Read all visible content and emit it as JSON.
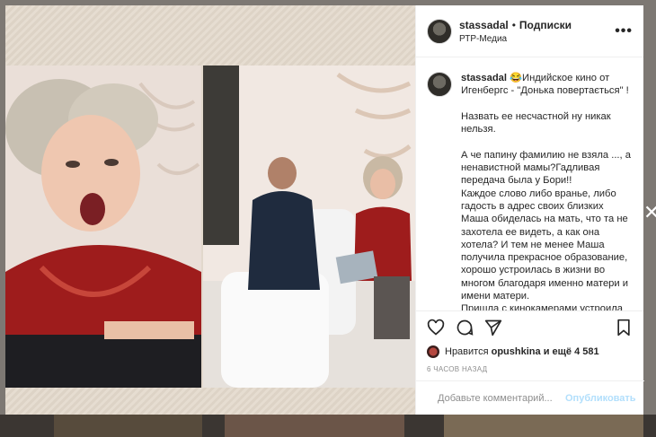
{
  "post": {
    "username": "stassadal",
    "separator": "•",
    "follow_label": "Подписки",
    "location": "РТР-Медиа",
    "more_glyph": "•••"
  },
  "caption": {
    "username": "stassadal",
    "text": "😂Индийское кино от Игенбергс - \"Донька повертається\" !\n\nНазвать ее несчастной ну никак нельзя.\n\nА че папину фамилию не взяла ..., а ненавистной мамы?Гадливая передача была у Бори!!\nКаждое слово либо вранье, либо гадость в адрес своих близких\nМаша обиделась на мать, что та не захотела ее видеть, а как она хотела? И тем не менее Маша получила прекрасное образование, хорошо устроилась в жизни во многом благодаря именно матери и имени матери.\nПришла с кинокамерами устроила видеосъёмку в стиле индийско-"
  },
  "likes": {
    "prefix": "Нравится",
    "user": "opushkina",
    "suffix": "и ещё 4 581"
  },
  "timestamp": "6 ЧАСОВ НАЗАД",
  "comment_box": {
    "placeholder": "Добавьте комментарий...",
    "publish_label": "Опубликовать"
  },
  "media": {
    "overlay_text": "Х"
  },
  "icons": [
    "avatar",
    "heart-icon",
    "comment-icon",
    "share-icon",
    "bookmark-icon",
    "emoji-icon",
    "more-icon"
  ],
  "colors": {
    "accent": "#0095f6",
    "publish_disabled": "#b2dffc",
    "text": "#262626",
    "muted": "#8e8e8e",
    "dress": "#9e1c1c"
  }
}
